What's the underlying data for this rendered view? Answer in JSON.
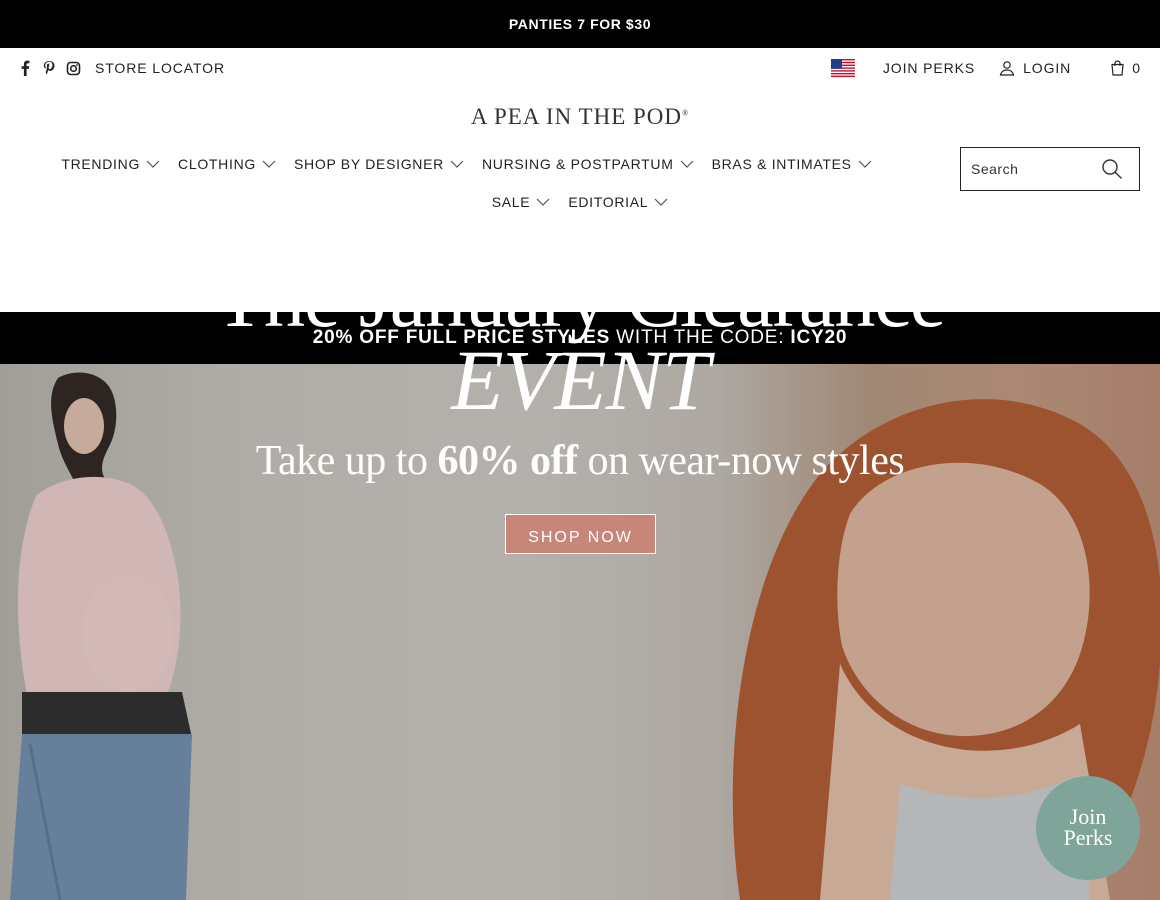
{
  "announcement": "PANTIES 7 FOR $30",
  "utility": {
    "store_locator": "STORE LOCATOR",
    "join_perks": "JOIN PERKS",
    "login": "LOGIN",
    "cart_count": "0",
    "social_icons": [
      "facebook-icon",
      "pinterest-icon",
      "instagram-icon"
    ]
  },
  "logo": "A PEA IN THE POD",
  "nav": {
    "row1": [
      "TRENDING",
      "CLOTHING",
      "SHOP BY DESIGNER",
      "NURSING & POSTPARTUM",
      "BRAS & INTIMATES"
    ],
    "row2": [
      "SALE",
      "EDITORIAL"
    ]
  },
  "search": {
    "placeholder": "Search"
  },
  "promo": {
    "bold_part": "20% OFF FULL PRICE STYLES",
    "mid": "WITH THE CODE:",
    "code": "ICY20"
  },
  "hero": {
    "title_line1": "The January Clearance",
    "title_line2": "EVENT",
    "sub_pre": "Take up to",
    "sub_bold": "60% off",
    "sub_post": "on wear-now styles",
    "button": "SHOP NOW"
  },
  "perks_badge": {
    "line1": "Join",
    "line2": "Perks"
  },
  "colors": {
    "black": "#000000",
    "button": "#c7867a",
    "perks": "#7fa59b"
  }
}
